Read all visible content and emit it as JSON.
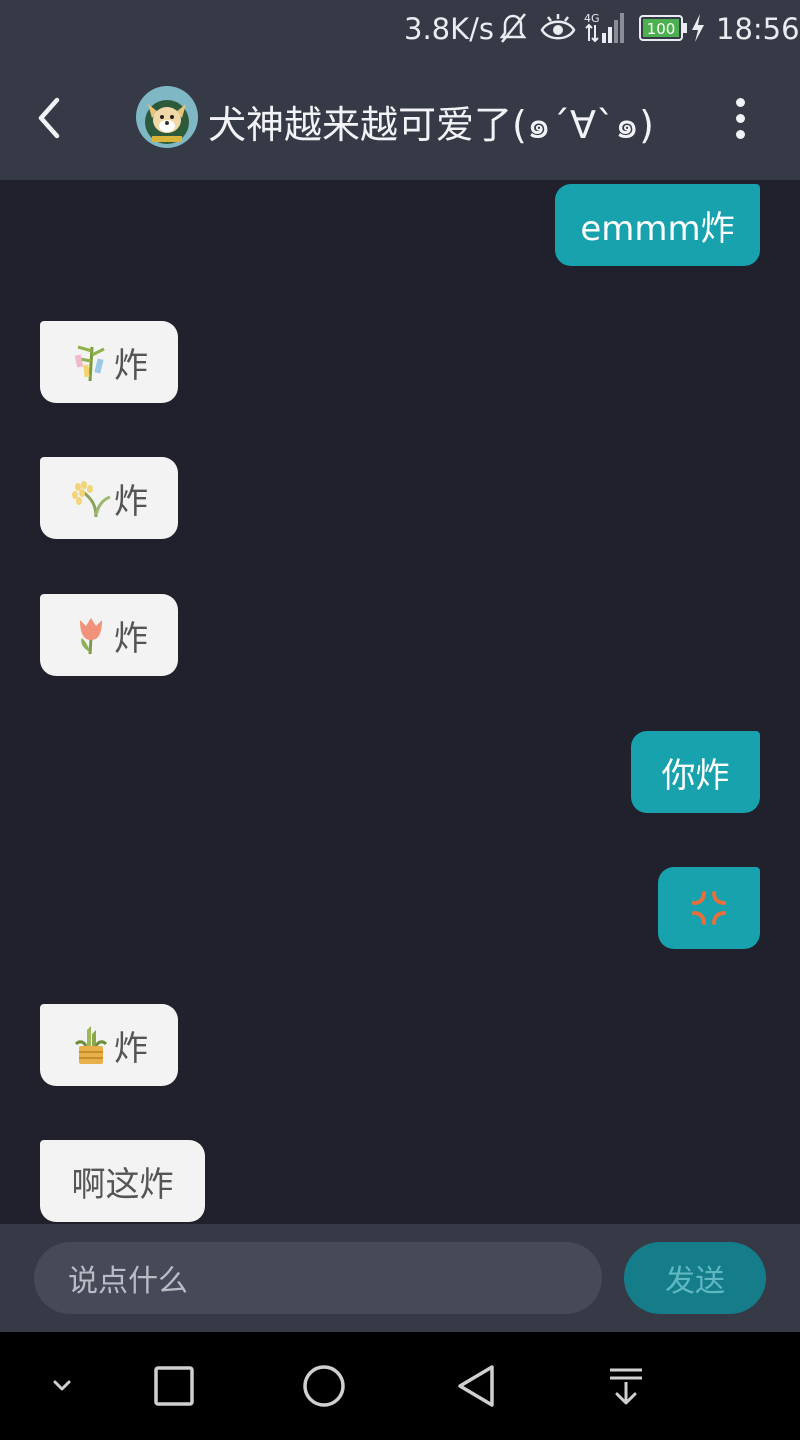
{
  "status_bar": {
    "net_speed": "3.8K/s",
    "battery": "100",
    "time": "18:56",
    "icons": [
      "mute-icon",
      "eye-icon",
      "signal-4g-icon",
      "battery-icon",
      "charging-icon"
    ]
  },
  "header": {
    "title": "犬神越来越可爱了(๑´∀`๑)",
    "back_icon": "chevron-left-icon",
    "more_icon": "more-vertical-icon"
  },
  "messages": [
    {
      "side": "out",
      "text": "emmm炸"
    },
    {
      "side": "in",
      "emoji": "tanabata-tree",
      "text": "炸"
    },
    {
      "side": "in",
      "emoji": "rice-ear",
      "text": "炸"
    },
    {
      "side": "in",
      "emoji": "tulip",
      "text": "炸"
    },
    {
      "side": "out",
      "text": "你炸"
    },
    {
      "side": "out",
      "emoji": "anger-symbol",
      "text": ""
    },
    {
      "side": "in",
      "emoji": "kadomatsu",
      "text": "炸"
    },
    {
      "side": "in",
      "text": "啊这炸"
    }
  ],
  "input": {
    "placeholder": "说点什么",
    "send_label": "发送"
  },
  "colors": {
    "bar_bg": "#363a47",
    "chat_bg": "#21212d",
    "incoming_bubble": "#f3f3f3",
    "outgoing_bubble": "#17a2ae",
    "send_button": "#157d8a"
  },
  "nav_bar": {
    "icons": [
      "chevron-down-icon",
      "recents-square-icon",
      "home-circle-icon",
      "back-triangle-icon",
      "notification-pull-icon"
    ]
  }
}
